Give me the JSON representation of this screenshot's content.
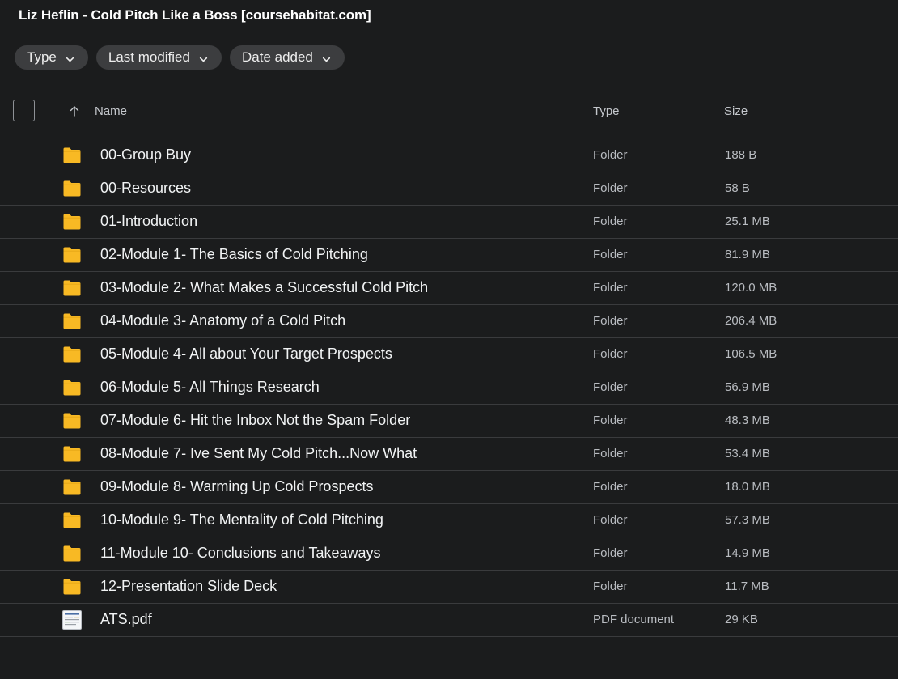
{
  "window": {
    "title": "Liz Heflin - Cold Pitch Like a Boss [coursehabitat.com]"
  },
  "filters": [
    {
      "label": "Type"
    },
    {
      "label": "Last modified"
    },
    {
      "label": "Date added"
    }
  ],
  "table": {
    "headers": {
      "name": "Name",
      "type": "Type",
      "size": "Size"
    },
    "sort_icon": "arrow-up-icon",
    "rows": [
      {
        "name": "00-Group Buy",
        "type": "Folder",
        "size": "188 B",
        "icon": "folder-icon"
      },
      {
        "name": "00-Resources",
        "type": "Folder",
        "size": "58 B",
        "icon": "folder-icon"
      },
      {
        "name": "01-Introduction",
        "type": "Folder",
        "size": "25.1 MB",
        "icon": "folder-icon"
      },
      {
        "name": "02-Module 1- The Basics of Cold Pitching",
        "type": "Folder",
        "size": "81.9 MB",
        "icon": "folder-icon"
      },
      {
        "name": "03-Module 2- What Makes a Successful Cold Pitch",
        "type": "Folder",
        "size": "120.0 MB",
        "icon": "folder-icon"
      },
      {
        "name": "04-Module 3- Anatomy of a Cold Pitch",
        "type": "Folder",
        "size": "206.4 MB",
        "icon": "folder-icon"
      },
      {
        "name": "05-Module 4- All about Your Target Prospects",
        "type": "Folder",
        "size": "106.5 MB",
        "icon": "folder-icon"
      },
      {
        "name": "06-Module 5- All Things Research",
        "type": "Folder",
        "size": "56.9 MB",
        "icon": "folder-icon"
      },
      {
        "name": "07-Module 6- Hit the Inbox Not the Spam Folder",
        "type": "Folder",
        "size": "48.3 MB",
        "icon": "folder-icon"
      },
      {
        "name": "08-Module 7- Ive Sent My Cold Pitch...Now What",
        "type": "Folder",
        "size": "53.4 MB",
        "icon": "folder-icon"
      },
      {
        "name": "09-Module 8- Warming Up Cold Prospects",
        "type": "Folder",
        "size": "18.0 MB",
        "icon": "folder-icon"
      },
      {
        "name": "10-Module 9- The Mentality of Cold Pitching",
        "type": "Folder",
        "size": "57.3 MB",
        "icon": "folder-icon"
      },
      {
        "name": "11-Module 10- Conclusions and Takeaways",
        "type": "Folder",
        "size": "14.9 MB",
        "icon": "folder-icon"
      },
      {
        "name": "12-Presentation Slide Deck",
        "type": "Folder",
        "size": "11.7 MB",
        "icon": "folder-icon"
      },
      {
        "name": "ATS.pdf",
        "type": "PDF document",
        "size": "29 KB",
        "icon": "pdf-thumbnail-icon"
      }
    ]
  },
  "colors": {
    "background": "#1b1c1d",
    "chip": "#3c3d3f",
    "folder": "#f8b924",
    "divider": "#3a3b3d"
  }
}
